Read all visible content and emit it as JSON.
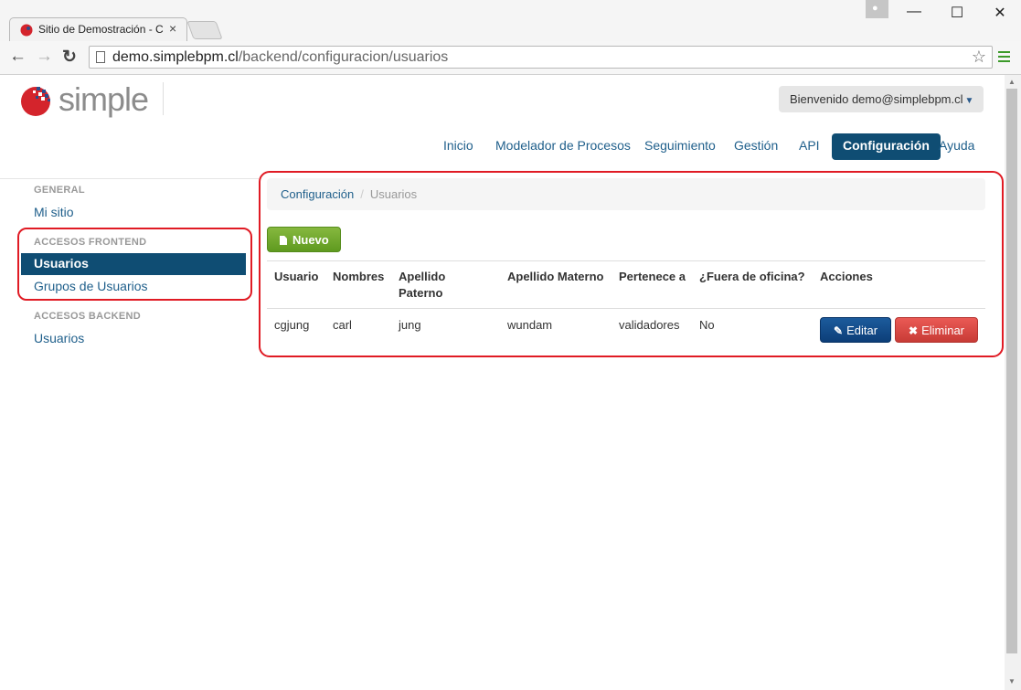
{
  "browser": {
    "tab_title": "Sitio de Demostración - C",
    "tab_close": "×",
    "url_host": "demo.simplebpm.cl",
    "url_path": "/backend/configuracion/usuarios",
    "back": "←",
    "forward": "→",
    "reload": "↻",
    "star": "☆",
    "minimize": "—",
    "maximize": "☐",
    "close": "✕",
    "user_glyph": "👤"
  },
  "header": {
    "logo_text": "simple",
    "user_menu": "Bienvenido demo@simplebpm.cl",
    "user_menu_caret": "▼"
  },
  "nav": {
    "items": [
      "Inicio",
      "Modelador de Procesos",
      "Seguimiento",
      "Gestión",
      "API",
      "Configuración",
      "Ayuda"
    ],
    "active": "Configuración"
  },
  "sidebar": {
    "general_header": "GENERAL",
    "mi_sitio": "Mi sitio",
    "frontend_header": "ACCESOS FRONTEND",
    "frontend_usuarios": "Usuarios",
    "frontend_grupos": "Grupos de Usuarios",
    "backend_header": "ACCESOS BACKEND",
    "backend_usuarios": "Usuarios"
  },
  "breadcrumb": {
    "root": "Configuración",
    "separator": "/",
    "current": "Usuarios"
  },
  "actions": {
    "nuevo": "Nuevo"
  },
  "table": {
    "headers": {
      "usuario": "Usuario",
      "nombres": "Nombres",
      "apellido_paterno_1": "Apellido",
      "apellido_paterno_2": "Paterno",
      "apellido_materno": "Apellido Materno",
      "pertenece": "Pertenece a",
      "fuera": "¿Fuera de oficina?",
      "acciones": "Acciones"
    },
    "rows": [
      {
        "usuario": "cgjung",
        "nombres": "carl",
        "apellido_paterno": "jung",
        "apellido_materno": "wundam",
        "pertenece": "validadores",
        "fuera": "No",
        "editar": "Editar",
        "editar_icon": "✎",
        "eliminar": "Eliminar",
        "eliminar_icon": "✖"
      }
    ]
  },
  "colors": {
    "primary": "#0f4d73",
    "link": "#1f5f8b",
    "success": "#6fa52b",
    "danger": "#d9534f",
    "highlight": "#e01b24"
  }
}
